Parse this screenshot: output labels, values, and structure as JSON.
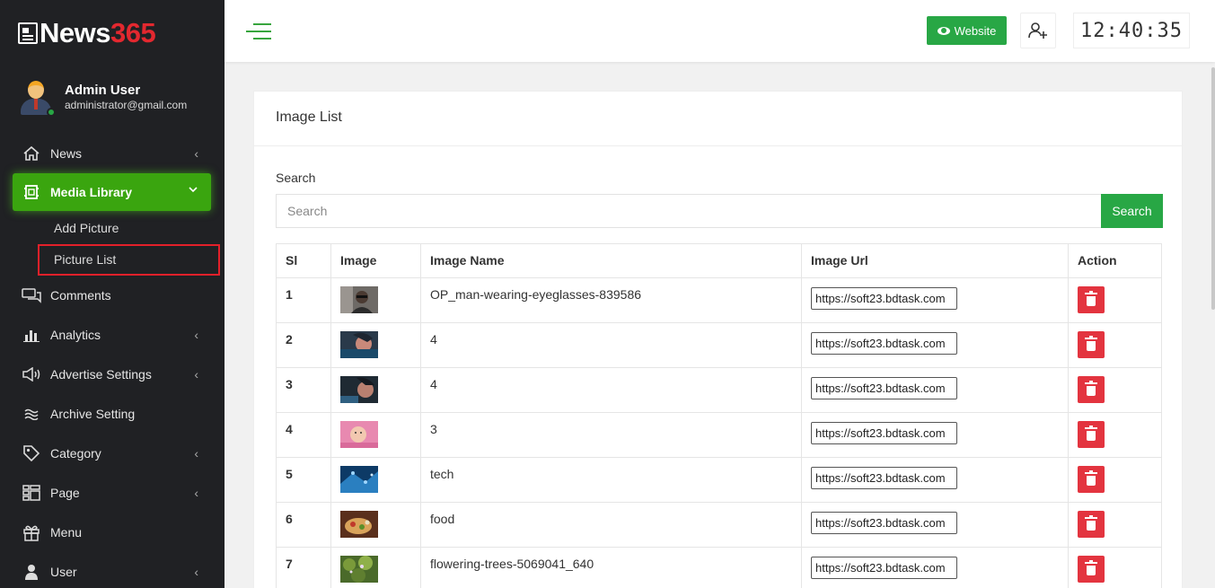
{
  "brand": {
    "name_prefix": "News",
    "name_number": "365"
  },
  "user": {
    "name": "Admin User",
    "email": "administrator@gmail.com"
  },
  "sidebar": {
    "items": [
      {
        "label": "News",
        "icon": "home-icon",
        "chevron": "‹"
      },
      {
        "label": "Media Library",
        "icon": "media-icon",
        "chevron": "⌄",
        "active": true
      },
      {
        "label": "Comments",
        "icon": "comments-icon"
      },
      {
        "label": "Analytics",
        "icon": "analytics-icon",
        "chevron": "‹"
      },
      {
        "label": "Advertise Settings",
        "icon": "megaphone-icon",
        "chevron": "‹"
      },
      {
        "label": "Archive Setting",
        "icon": "archive-icon"
      },
      {
        "label": "Category",
        "icon": "tag-icon",
        "chevron": "‹"
      },
      {
        "label": "Page",
        "icon": "page-icon",
        "chevron": "‹"
      },
      {
        "label": "Menu",
        "icon": "gift-icon"
      },
      {
        "label": "User",
        "icon": "user-icon",
        "chevron": "‹"
      }
    ],
    "submenu": [
      {
        "label": "Add Picture"
      },
      {
        "label": "Picture List",
        "highlighted": true
      }
    ]
  },
  "topbar": {
    "website_label": "Website",
    "clock": "12:40:35"
  },
  "main": {
    "card_title": "Image List",
    "search_label": "Search",
    "search_placeholder": "Search",
    "search_button": "Search",
    "columns": [
      "Sl",
      "Image",
      "Image Name",
      "Image Url",
      "Action"
    ],
    "rows": [
      {
        "sl": "1",
        "name": "OP_man-wearing-eyeglasses-839586",
        "url": "https://soft23.bdtask.com"
      },
      {
        "sl": "2",
        "name": "4",
        "url": "https://soft23.bdtask.com"
      },
      {
        "sl": "3",
        "name": "4",
        "url": "https://soft23.bdtask.com"
      },
      {
        "sl": "4",
        "name": "3",
        "url": "https://soft23.bdtask.com"
      },
      {
        "sl": "5",
        "name": "tech",
        "url": "https://soft23.bdtask.com"
      },
      {
        "sl": "6",
        "name": "food",
        "url": "https://soft23.bdtask.com"
      },
      {
        "sl": "7",
        "name": "flowering-trees-5069041_640",
        "url": "https://soft23.bdtask.com"
      }
    ]
  },
  "colors": {
    "accent_green": "#28a745",
    "active_green": "#3aa50f",
    "danger": "#e3343f",
    "sidebar_bg": "#202124",
    "brand_red": "#e3282f"
  }
}
